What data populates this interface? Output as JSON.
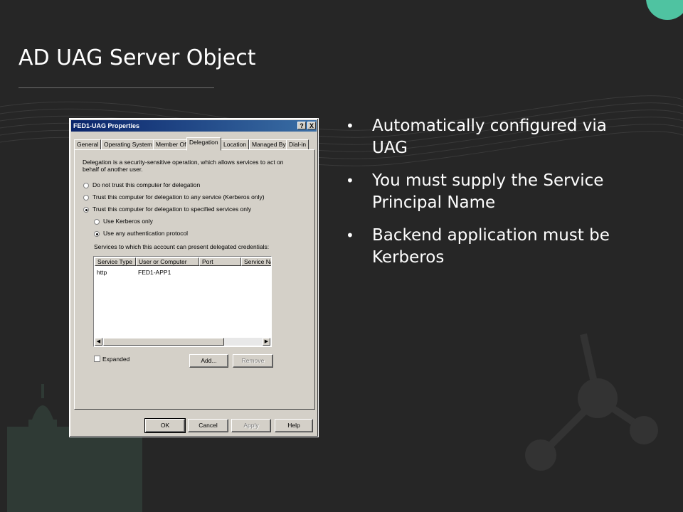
{
  "slide": {
    "title": "AD UAG Server Object",
    "bullets": [
      "Automatically configured via UAG",
      "You must supply the Service Principal Name",
      "Backend application must be Kerberos"
    ]
  },
  "dialog": {
    "title": "FED1-UAG Properties",
    "help_button": "?",
    "close_button": "X",
    "tabs": [
      "General",
      "Operating System",
      "Member Of",
      "Delegation",
      "Location",
      "Managed By",
      "Dial-in"
    ],
    "active_tab": "Delegation",
    "description_line1": "Delegation is a security-sensitive operation, which allows services to act on",
    "description_line2": "behalf of another user.",
    "radio_no_trust": "Do not trust this computer for delegation",
    "radio_trust_any": "Trust this computer for delegation to any service (Kerberos only)",
    "radio_trust_specified": "Trust this computer for delegation to specified services only",
    "radio_kerberos_only": "Use Kerberos only",
    "radio_any_protocol": "Use any authentication protocol",
    "services_label": "Services to which this account can present delegated credentials:",
    "columns": [
      "Service Type",
      "User or Computer",
      "Port",
      "Service Na"
    ],
    "rows": [
      {
        "service_type": "http",
        "user_or_computer": "FED1-APP1",
        "port": "",
        "service_name": ""
      }
    ],
    "expanded_label": "Expanded",
    "add_button": "Add...",
    "remove_button": "Remove",
    "ok_button": "OK",
    "cancel_button": "Cancel",
    "apply_button": "Apply",
    "help_label": "Help"
  },
  "colors": {
    "background": "#262626",
    "accent": "#4fc3a1"
  }
}
